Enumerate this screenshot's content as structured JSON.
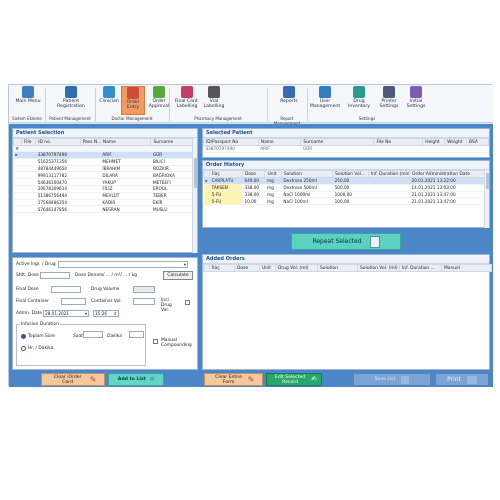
{
  "ribbon": {
    "buttons": [
      {
        "label": "Main Menu",
        "icon": "grid-menu-icon",
        "color": "#3f7fbf"
      },
      {
        "label": "Patient Registration",
        "icon": "patient-icon",
        "color": "#2f6fb0"
      },
      {
        "label": "Clinician",
        "icon": "clinician-icon",
        "color": "#2f8fd0"
      },
      {
        "label": "Order Entry",
        "icon": "order-entry-icon",
        "color": "#c94f3a"
      },
      {
        "label": "Order Approval",
        "icon": "check-icon",
        "color": "#5aa83a"
      },
      {
        "label": "Final Cont. Labelling",
        "icon": "vial-label-icon",
        "color": "#c83b6a"
      },
      {
        "label": "Vial Labelling",
        "icon": "barcode-icon",
        "color": "#555555"
      },
      {
        "label": "Reports",
        "icon": "report-icon",
        "color": "#3a6ab0"
      },
      {
        "label": "User Management",
        "icon": "users-icon",
        "color": "#2f7fc0"
      },
      {
        "label": "Drug Inventory",
        "icon": "inventory-icon",
        "color": "#2a9a8a"
      },
      {
        "label": "Printer Settings",
        "icon": "printer-icon",
        "color": "#4a5a7a"
      },
      {
        "label": "Initial Settings",
        "icon": "settings-icon",
        "color": "#7a5fb0"
      }
    ],
    "groups": [
      "Sistem Ekleme",
      "Patient Management",
      "Doctor Management",
      "Pharmacy Management",
      "Report Management",
      "Settings"
    ]
  },
  "patient_selection": {
    "title": "Patient Selection",
    "columns": [
      "File",
      "ID no.",
      "Pass.N...",
      "Name",
      "Surname"
    ],
    "rows": [
      [
        "",
        "33870797490",
        "",
        "ARIF",
        "GÜR"
      ],
      [
        "",
        "51625371356",
        "",
        "MEHMET",
        "BILICI"
      ],
      [
        "",
        "48784449650",
        "",
        "İBRAHIM",
        "BOZKIR"
      ],
      [
        "",
        "99913117782",
        "",
        "DILARA",
        "BAĞRIOKA"
      ],
      [
        "",
        "54636100470",
        "",
        "YAKUP",
        "METEEFI"
      ],
      [
        "",
        "20678309614",
        "",
        "FİLİZ",
        "EROGL"
      ],
      [
        "",
        "51386756494",
        "",
        "MEVLÜT",
        "TEBER"
      ],
      [
        "",
        "17568486354",
        "",
        "KADIR",
        "EKİR"
      ],
      [
        "",
        "57646147856",
        "",
        "NESRAN",
        "MUSLU"
      ]
    ]
  },
  "form": {
    "active_ingr_label": "Active Ingr. / Drug",
    "std_dose_label": "Stdt. Dose",
    "dose_denom_label": "Dose Denom",
    "dose_denom_options": "/ ... / m²/ ... / kg",
    "calculate_label": "Calculate",
    "final_dose_label": "Final Dose",
    "drug_volume_label": "Drug Volume",
    "final_container_label": "Final Container",
    "container_vol_label": "Container Vol.",
    "incl_drug_vol_label": "Incl. Drug Vol.",
    "admin_date_label": "Admn. Date",
    "admin_date_value": "28.01.2021",
    "admin_time_value": "15:26",
    "infusion_duration_label": "Infusion Duration",
    "total_label": "Toplam Süre",
    "saat_label": "Saat",
    "dakika_label": "Dakika",
    "hr_min_label": "Hr. / Dakika",
    "manual_compounding_label": "Manual Compounding"
  },
  "selected_patient": {
    "title": "Selected Patient",
    "columns": [
      "ID/Passport No",
      "Name",
      "Surname",
      "File No",
      "Height",
      "Weight",
      "BSA"
    ],
    "values": [
      "33870797490",
      "ARIF",
      "GÜR",
      "",
      "",
      "",
      ""
    ]
  },
  "order_history": {
    "title": "Order History",
    "columns": [
      "İlaç",
      "Dose",
      "Unit",
      "Solution",
      "Solution Vol...",
      "Inf. Duration (min)",
      "Order Administration Date"
    ],
    "rows": [
      [
        "CARPLATU",
        "649,00",
        "mg",
        "Dextrose 250ml",
        "250,00",
        "",
        "20.01.2021 13:22:00"
      ],
      [
        "TAKSEN",
        "338,00",
        "mg",
        "Dextrose 500ml",
        "500,00",
        "",
        "14.01.2021 13:03:00"
      ],
      [
        "5-FU",
        "338,00",
        "mg",
        "NaCl 1000ml",
        "1000,00",
        "",
        "21.01.2021 13:47:00"
      ],
      [
        "5-FU",
        "10,00",
        "mg",
        "NaCl 100ml",
        "100,00",
        "",
        "21.01.2021 13:47:00"
      ]
    ],
    "repeat_label": "Repeat Selected"
  },
  "added_orders": {
    "title": "Added Orders",
    "columns": [
      "İlaç",
      "Dose",
      "Unit",
      "Drug Vol. (ml)",
      "Solution",
      "Solution Vol. (ml)",
      "Inf. Duration ...",
      "Manuel"
    ]
  },
  "bottom": {
    "clear_order_card": "Clear iOrder Card",
    "add_to_list": "Add to List",
    "clear_entire_form": "Clear Entire Form",
    "edit_selected_record": "Edit Selected Record",
    "save_list": "Save List",
    "print": "Print"
  }
}
